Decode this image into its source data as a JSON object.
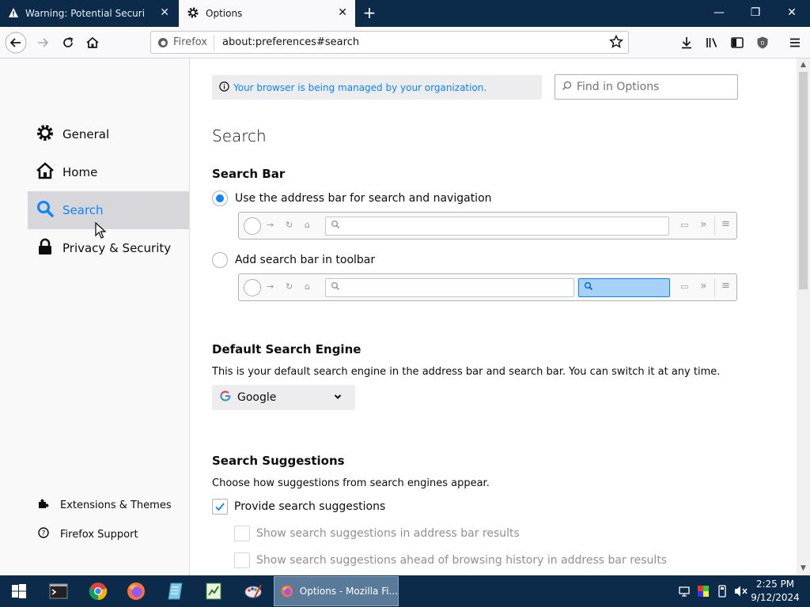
{
  "browser": {
    "tabs": [
      {
        "title": "Warning: Potential Security Risk Ahead",
        "active": false,
        "icon": "warning-icon"
      },
      {
        "title": "Options",
        "active": true,
        "icon": "gear-icon"
      }
    ],
    "identity_label": "Firefox",
    "url": "about:preferences#search"
  },
  "sidebar": {
    "categories": [
      {
        "label": "General",
        "icon": "gear-icon",
        "selected": false
      },
      {
        "label": "Home",
        "icon": "home-icon",
        "selected": false
      },
      {
        "label": "Search",
        "icon": "search-icon",
        "selected": true
      },
      {
        "label": "Privacy & Security",
        "icon": "lock-icon",
        "selected": false
      }
    ],
    "footer": [
      {
        "label": "Extensions & Themes",
        "icon": "puzzle-icon"
      },
      {
        "label": "Firefox Support",
        "icon": "help-icon"
      }
    ]
  },
  "main": {
    "managed_notice": "Your browser is being managed by your organization.",
    "find_placeholder": "Find in Options",
    "page_title": "Search",
    "search_bar": {
      "heading": "Search Bar",
      "option_address": "Use the address bar for search and navigation",
      "option_toolbar": "Add search bar in toolbar",
      "selected": "address"
    },
    "default_engine": {
      "heading": "Default Search Engine",
      "description": "This is your default search engine in the address bar and search bar. You can switch it at any time.",
      "selected": "Google"
    },
    "suggestions": {
      "heading": "Search Suggestions",
      "description": "Choose how suggestions from search engines appear.",
      "provide": {
        "label": "Provide search suggestions",
        "checked": true
      },
      "in_address_bar": {
        "label": "Show search suggestions in address bar results",
        "checked": false,
        "disabled": true
      },
      "ahead_of_history": {
        "label": "Show search suggestions ahead of browsing history in address bar results",
        "checked": false,
        "disabled": true
      }
    }
  },
  "taskbar": {
    "active_window": "Options - Mozilla Fi...",
    "time": "2:25 PM",
    "date": "9/12/2024"
  },
  "colors": {
    "accent": "#0a84ff",
    "taskbar": "#0c2a4a"
  }
}
